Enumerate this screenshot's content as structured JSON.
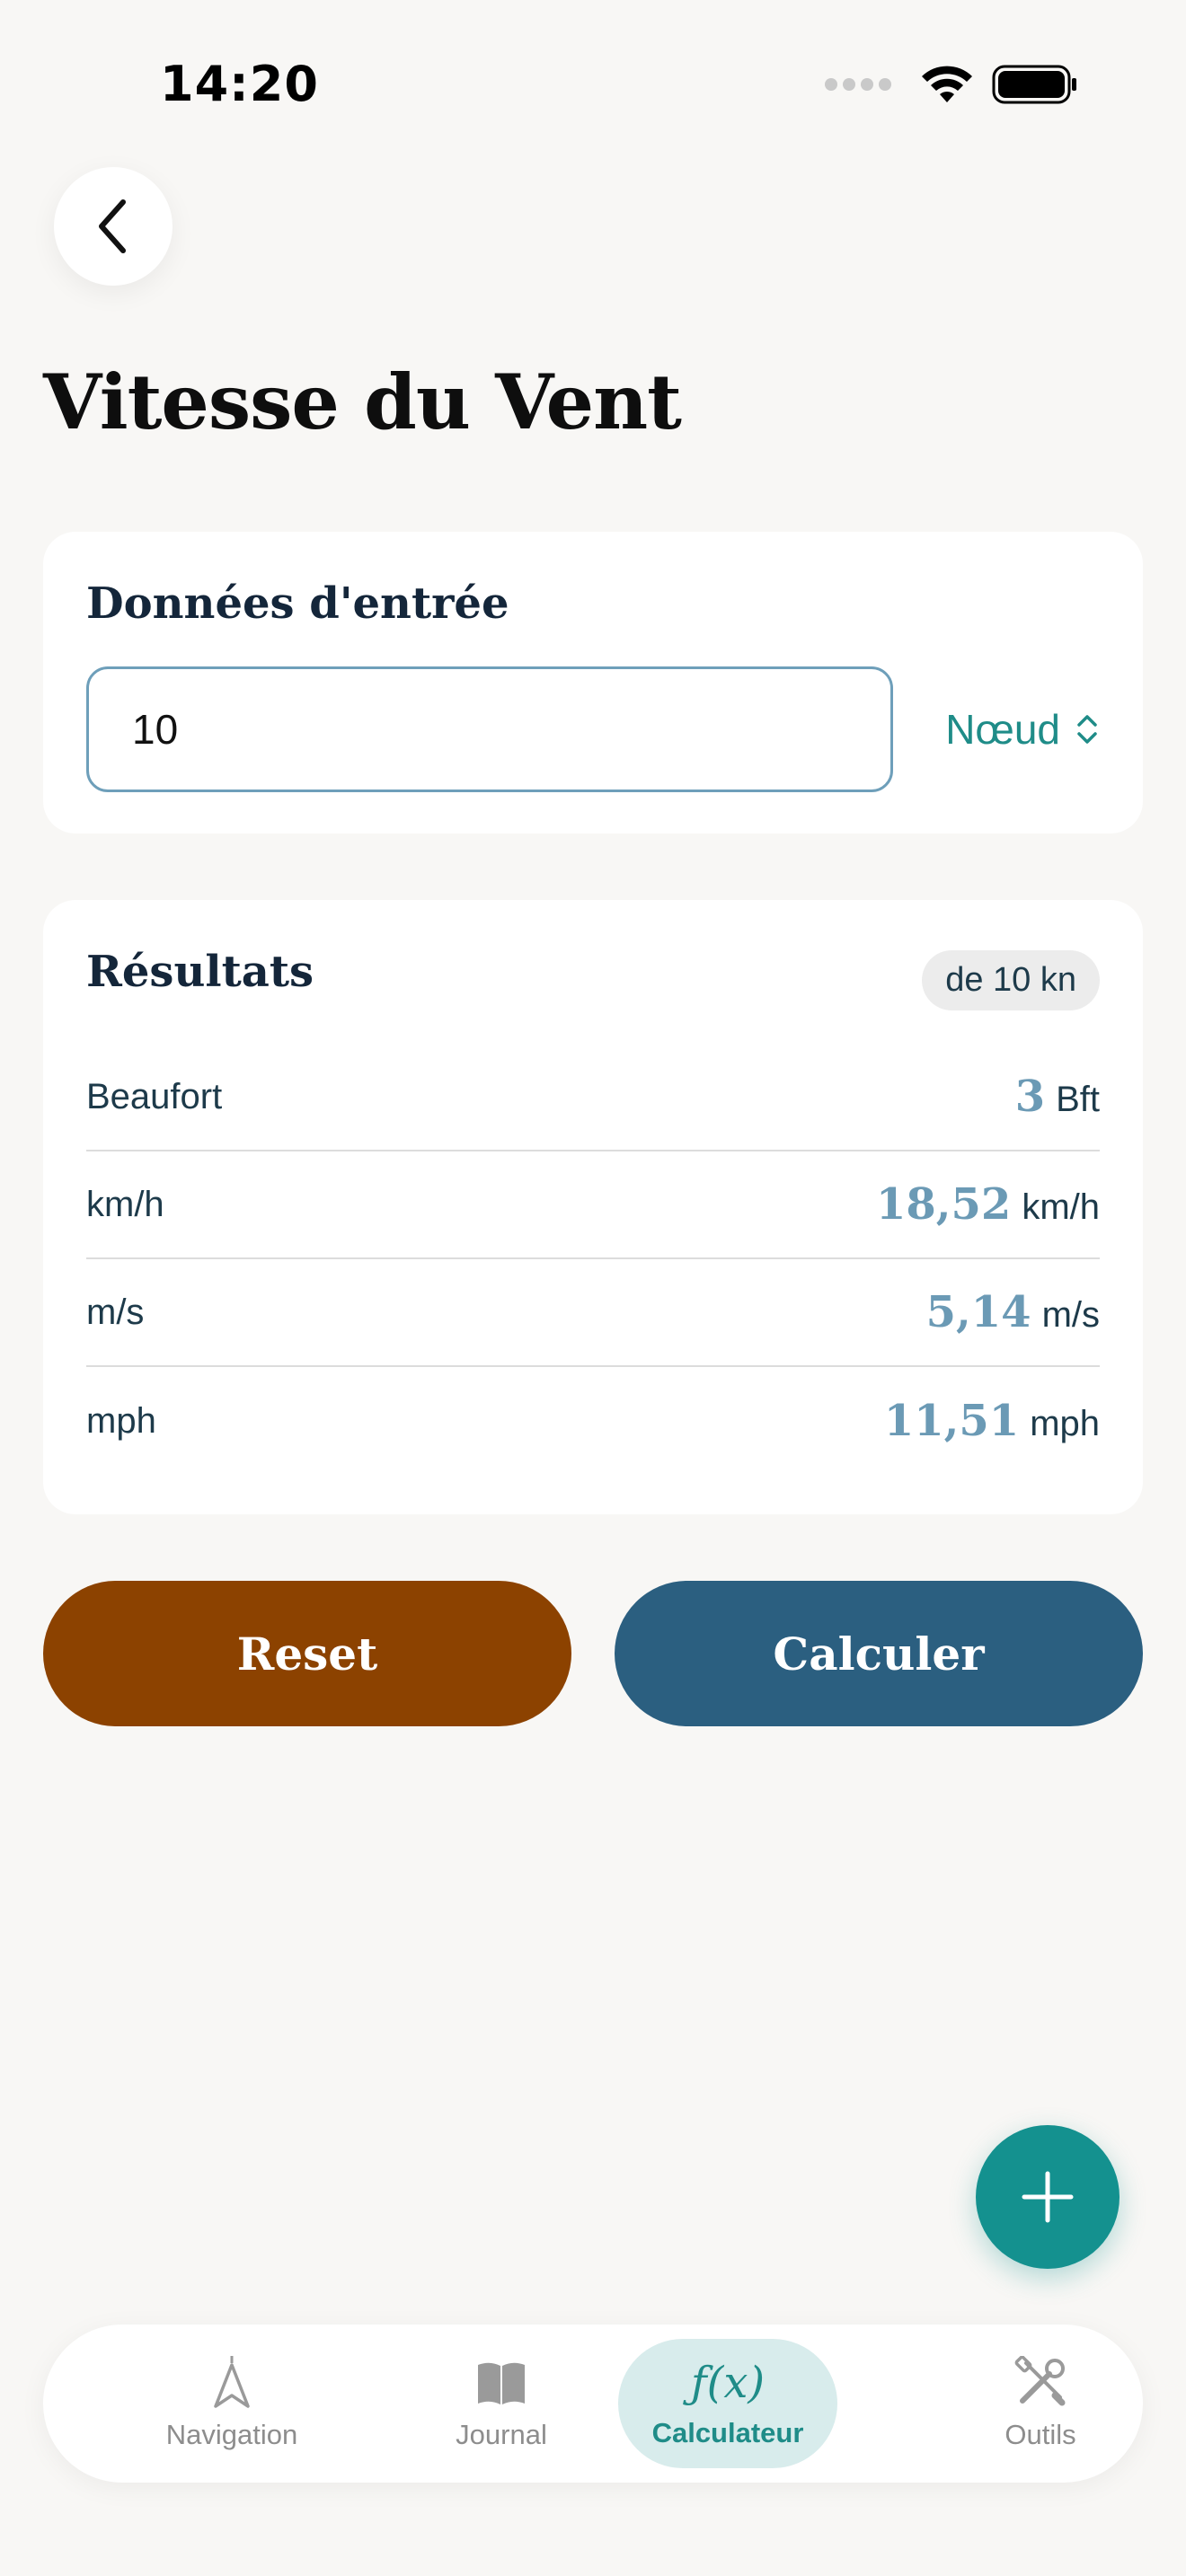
{
  "status_bar": {
    "time": "14:20"
  },
  "header": {
    "title": "Vitesse du Vent"
  },
  "input_card": {
    "title": "Données d'entrée",
    "value": "10",
    "unit": "Nœud"
  },
  "results_card": {
    "title": "Résultats",
    "badge": "de 10 kn",
    "rows": [
      {
        "label": "Beaufort",
        "value": "3",
        "unit": "Bft"
      },
      {
        "label": "km/h",
        "value": "18,52",
        "unit": "km/h"
      },
      {
        "label": "m/s",
        "value": "5,14",
        "unit": "m/s"
      },
      {
        "label": "mph",
        "value": "11,51",
        "unit": "mph"
      }
    ]
  },
  "actions": {
    "reset_label": "Reset",
    "calculate_label": "Calculer"
  },
  "bottom_nav": {
    "items": [
      {
        "label": "Navigation",
        "icon": "compass-arrow-icon"
      },
      {
        "label": "Journal",
        "icon": "book-icon"
      },
      {
        "label": "Calculateur",
        "icon": "fx-icon",
        "glyph": "ƒ(x)",
        "active": true
      },
      {
        "label": "Outils",
        "icon": "tools-icon"
      }
    ]
  },
  "colors": {
    "accent": "#1f8c88",
    "reset": "#8c4200",
    "calculate": "#2b5f80",
    "result_value": "#6b9ab5",
    "background": "#f8f7f5"
  }
}
